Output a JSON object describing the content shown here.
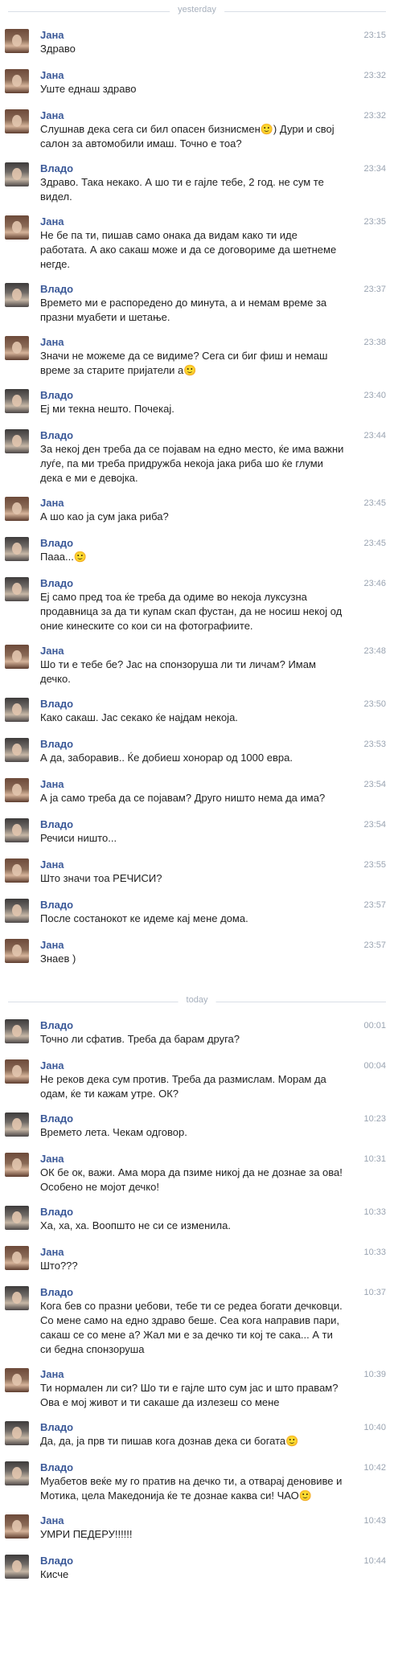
{
  "dividers": {
    "yesterday": "yesterday",
    "today": "today"
  },
  "messages_yesterday": [
    {
      "sender": "Јана",
      "avatar": "jana",
      "time": "23:15",
      "text": "Здраво"
    },
    {
      "sender": "Јана",
      "avatar": "jana",
      "time": "23:32",
      "text": "Уште еднаш здраво"
    },
    {
      "sender": "Јана",
      "avatar": "jana",
      "time": "23:32",
      "text": "Слушнав дека сега си бил опасен бизнисмен🙂) Дури и свој салон за автомобили имаш. Точно е тоа?"
    },
    {
      "sender": "Влaдо",
      "avatar": "vlado",
      "time": "23:34",
      "text": "Здраво. Така некако. А шо ти е гајле тебе, 2 год. не сум те видел."
    },
    {
      "sender": "Јана",
      "avatar": "jana",
      "time": "23:35",
      "text": "Не бе па ти, пишав само онака да видам како ти иде работата. А ако сакаш може и да се договориме да шетнеме негде."
    },
    {
      "sender": "Влaдо",
      "avatar": "vlado",
      "time": "23:37",
      "text": "Времето ми е распоредено до минута, а и немам време за празни муабети и шетање."
    },
    {
      "sender": "Јана",
      "avatar": "jana",
      "time": "23:38",
      "text": "Значи не можеме да се видиме? Сега си биг фиш и немаш време за старите пријатели а🙂"
    },
    {
      "sender": "Влaдо",
      "avatar": "vlado",
      "time": "23:40",
      "text": "Еј ми текна нешто. Почекај."
    },
    {
      "sender": "Влaдо",
      "avatar": "vlado",
      "time": "23:44",
      "text": "За некој ден треба да се појавам на едно место, ќе има важни луѓе, па ми треба придружба некоја јака риба шо ќе глуми дека е ми е девојка."
    },
    {
      "sender": "Јана",
      "avatar": "jana",
      "time": "23:45",
      "text": "А шо као ја сум јака риба?"
    },
    {
      "sender": "Влaдо",
      "avatar": "vlado",
      "time": "23:45",
      "text": "Пааа...🙂"
    },
    {
      "sender": "Влaдо",
      "avatar": "vlado",
      "time": "23:46",
      "text": "Еј само пред тоа ќе треба да одиме во некоја луксузна продавница за да ти купам скап фустан, да не носиш некој од оние кинеските со кои си на фотографиите."
    },
    {
      "sender": "Јана",
      "avatar": "jana",
      "time": "23:48",
      "text": "Шо ти е тебе бе? Јас на спонзоруша ли ти личам? Имам дечко."
    },
    {
      "sender": "Влaдо",
      "avatar": "vlado",
      "time": "23:50",
      "text": "Како сакаш. Јас секако ќе најдам некоја."
    },
    {
      "sender": "Влaдо",
      "avatar": "vlado",
      "time": "23:53",
      "text": "А да, заборавив.. Ќе добиеш хонорар од 1000 евра."
    },
    {
      "sender": "Јана",
      "avatar": "jana",
      "time": "23:54",
      "text": "А ја само треба да се појавам? Друго ништо нема да има?"
    },
    {
      "sender": "Влaдо",
      "avatar": "vlado",
      "time": "23:54",
      "text": "Речиси ништо..."
    },
    {
      "sender": "Јана",
      "avatar": "jana",
      "time": "23:55",
      "text": "Што значи тоа РЕЧИСИ?"
    },
    {
      "sender": "Влaдо",
      "avatar": "vlado",
      "time": "23:57",
      "text": "После состанокот ке идеме кај мене дома."
    },
    {
      "sender": "Јана",
      "avatar": "jana",
      "time": "23:57",
      "text": "Знаев )"
    }
  ],
  "messages_today": [
    {
      "sender": "Влaдо",
      "avatar": "vlado",
      "time": "00:01",
      "text": "Точно ли сфатив. Треба да барам друга?"
    },
    {
      "sender": "Јана",
      "avatar": "jana",
      "time": "00:04",
      "text": "Не реков дека сум против. Треба да размислам. Морам да одам, ќе ти кажам утре. ОК?"
    },
    {
      "sender": "Влaдо",
      "avatar": "vlado",
      "time": "10:23",
      "text": "Времето лета. Чекам одговор."
    },
    {
      "sender": "Јана",
      "avatar": "jana",
      "time": "10:31",
      "text": "ОК бе ок, важи. Ама мора да пзиме никој да не дознае за ова! Особено не мојот дечко!"
    },
    {
      "sender": "Влaдо",
      "avatar": "vlado",
      "time": "10:33",
      "text": "Ха, ха, ха. Воопшто не си се изменила."
    },
    {
      "sender": "Јана",
      "avatar": "jana",
      "time": "10:33",
      "text": "Што???"
    },
    {
      "sender": "Влaдо",
      "avatar": "vlado",
      "time": "10:37",
      "text": "Кога бев со празни џебови, тебе ти се редеа богати дечковци. Со мене само на едно здраво беше. Сеа кога направив пари, сакаш се со мене а? Жал ми е за дечко ти кој те сака... А ти си бедна спонзоруша"
    },
    {
      "sender": "Јана",
      "avatar": "jana",
      "time": "10:39",
      "text": "Ти нормален ли си? Шо ти е гајле што сум јас и што правам? Ова е мој живот и ти сакаше да излезеш со мене"
    },
    {
      "sender": "Влaдо",
      "avatar": "vlado",
      "time": "10:40",
      "text": "Да, да, ја прв ти пишав кога дознав дека си богата🙂"
    },
    {
      "sender": "Влaдо",
      "avatar": "vlado",
      "time": "10:42",
      "text": "Муабетов веќе му го пратив на дечко ти, а отварај деновиве и Мотика, цела Македонија ќе те дознае каква си! ЧАО🙂"
    },
    {
      "sender": "Јана",
      "avatar": "jana",
      "time": "10:43",
      "text": "УМРИ ПЕДЕРУ!!!!!!"
    },
    {
      "sender": "Влaдо",
      "avatar": "vlado",
      "time": "10:44",
      "text": "Кисче"
    }
  ]
}
